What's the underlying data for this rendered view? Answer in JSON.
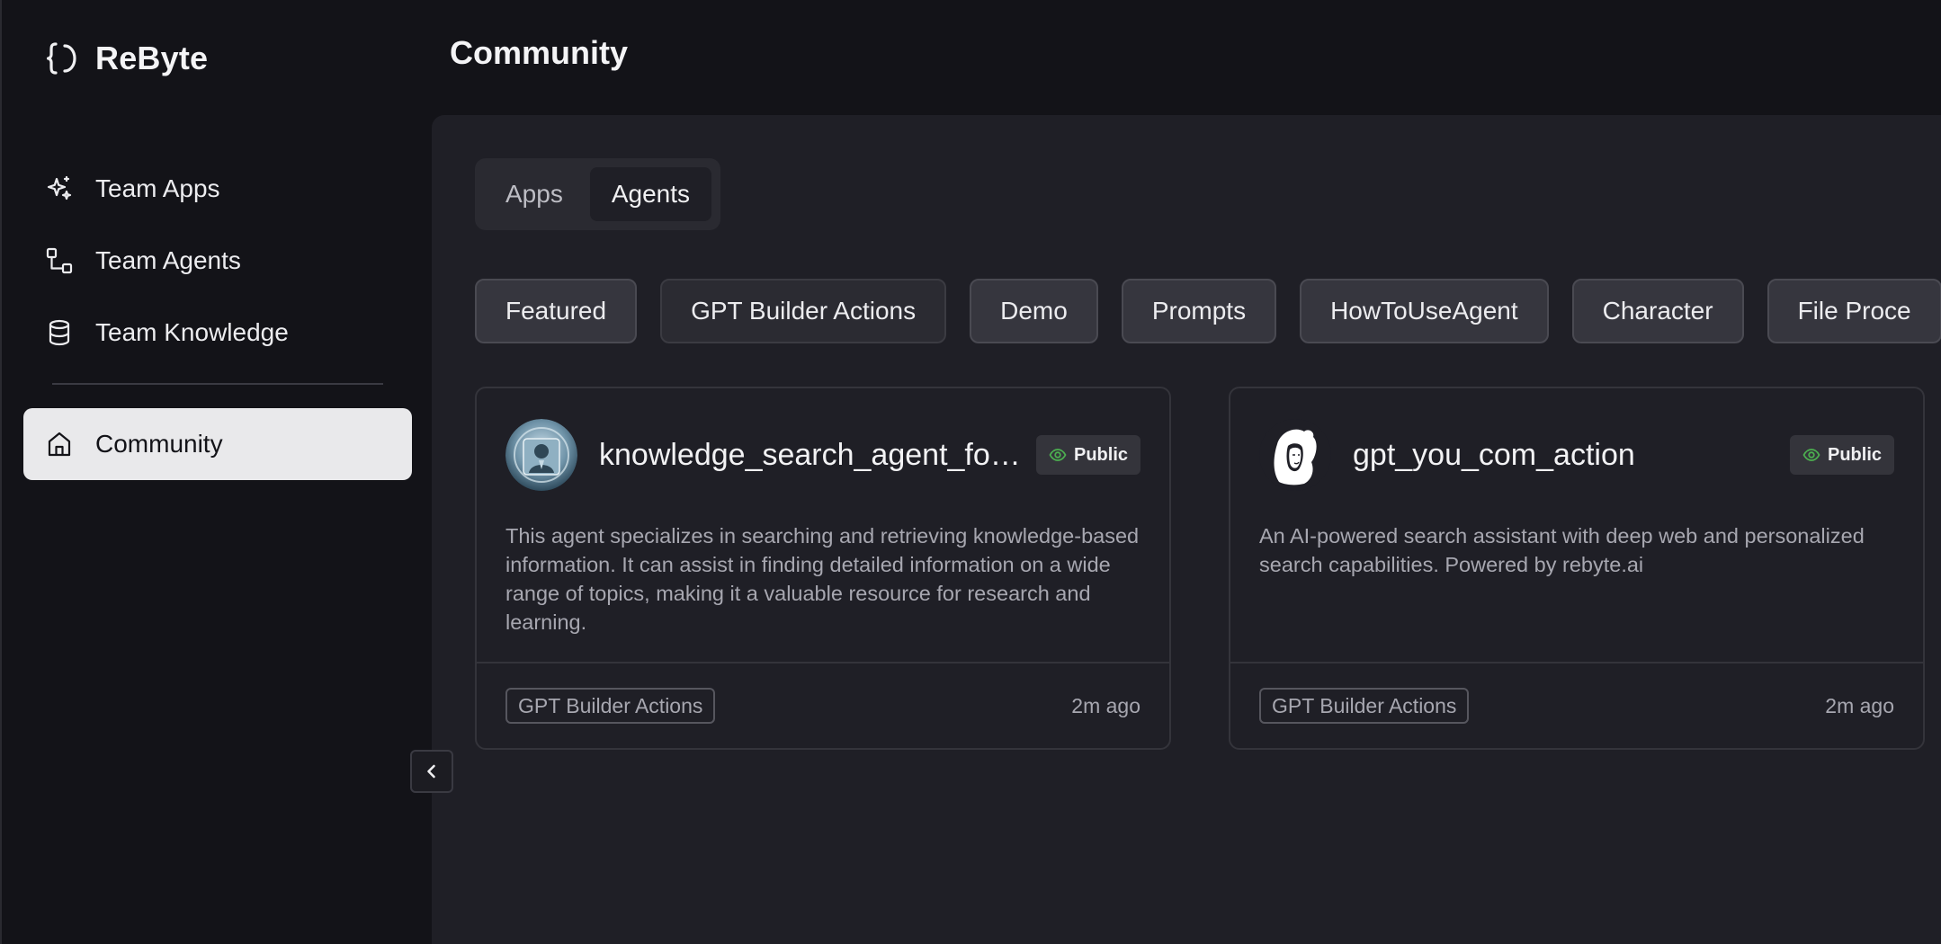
{
  "app": {
    "name": "ReByte",
    "logo_icon": "braces-logo-icon"
  },
  "sidebar": {
    "items": [
      {
        "label": "Team Apps",
        "icon": "sparkle-icon"
      },
      {
        "label": "Team Agents",
        "icon": "workflow-icon"
      },
      {
        "label": "Team Knowledge",
        "icon": "database-icon"
      }
    ],
    "community": {
      "label": "Community",
      "icon": "home-icon",
      "active": true
    }
  },
  "header": {
    "title": "Community"
  },
  "tabs": [
    {
      "label": "Apps",
      "active": false
    },
    {
      "label": "Agents",
      "active": true
    }
  ],
  "categories": [
    {
      "label": "Featured",
      "active": false
    },
    {
      "label": "GPT Builder Actions",
      "active": true
    },
    {
      "label": "Demo",
      "active": false
    },
    {
      "label": "Prompts",
      "active": false
    },
    {
      "label": "HowToUseAgent",
      "active": false
    },
    {
      "label": "Character",
      "active": false
    },
    {
      "label": "File Proce",
      "active": false
    }
  ],
  "cards": [
    {
      "title": "knowledge_search_agent_for_…",
      "badge": "Public",
      "description": "This agent specializes in searching and retrieving knowledge-based information. It can assist in finding detailed information on a wide range of topics, making it a valuable resource for research and learning.",
      "tag": "GPT Builder Actions",
      "time": "2m ago"
    },
    {
      "title": "gpt_you_com_action",
      "badge": "Public",
      "description": "An AI-powered search assistant with deep web and personalized search capabilities. Powered by rebyte.ai",
      "tag": "GPT Builder Actions",
      "time": "2m ago"
    }
  ],
  "colors": {
    "background": "#131318",
    "panel": "#1f1f26",
    "active_nav": "#e9e9eb",
    "public_eye": "#4caf50"
  }
}
